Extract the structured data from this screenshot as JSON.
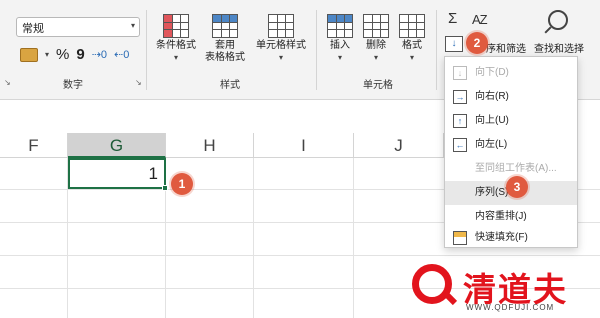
{
  "ribbon": {
    "number_format": {
      "value": "常规"
    },
    "number_group": {
      "percent_symbol": "%",
      "comma_symbol": "9",
      "label": "数字"
    },
    "styles_group": {
      "conditional_format": "条件格式",
      "table_format_line1": "套用",
      "table_format_line2": "表格格式",
      "cell_styles": "单元格样式",
      "label": "样式"
    },
    "cells_group": {
      "insert": "插入",
      "delete": "删除",
      "format": "格式",
      "label": "单元格"
    },
    "editing_group": {
      "sigma": "Σ",
      "sort_icon_text": "AZ",
      "sort_filter": "序和筛选",
      "find_select": "查找和选择"
    }
  },
  "sheet": {
    "columns": [
      "F",
      "G",
      "H",
      "I",
      "J"
    ],
    "selected_column": "G",
    "active_cell_value": "1"
  },
  "fill_menu": {
    "items": [
      {
        "label": "向下(D)",
        "icon": "↓",
        "disabled": true
      },
      {
        "label": "向右(R)",
        "icon": "→",
        "disabled": false
      },
      {
        "label": "向上(U)",
        "icon": "↑",
        "disabled": false
      },
      {
        "label": "向左(L)",
        "icon": "←",
        "disabled": false
      },
      {
        "label": "至同组工作表(A)...",
        "icon": "",
        "disabled": true
      },
      {
        "label": "序列(S)...",
        "icon": "",
        "disabled": false
      },
      {
        "label": "内容重排(J)",
        "icon": "",
        "disabled": false
      },
      {
        "label": "快速填充(F)",
        "icon": "",
        "disabled": false
      }
    ]
  },
  "badges": {
    "step1": "1",
    "step2": "2",
    "step3": "3"
  },
  "watermark": {
    "brand": "清道夫",
    "url": "WWW.QDFUJI.COM"
  },
  "colors": {
    "accent_green": "#1e7145",
    "badge": "#e05a3f",
    "watermark": "#e2141d"
  }
}
